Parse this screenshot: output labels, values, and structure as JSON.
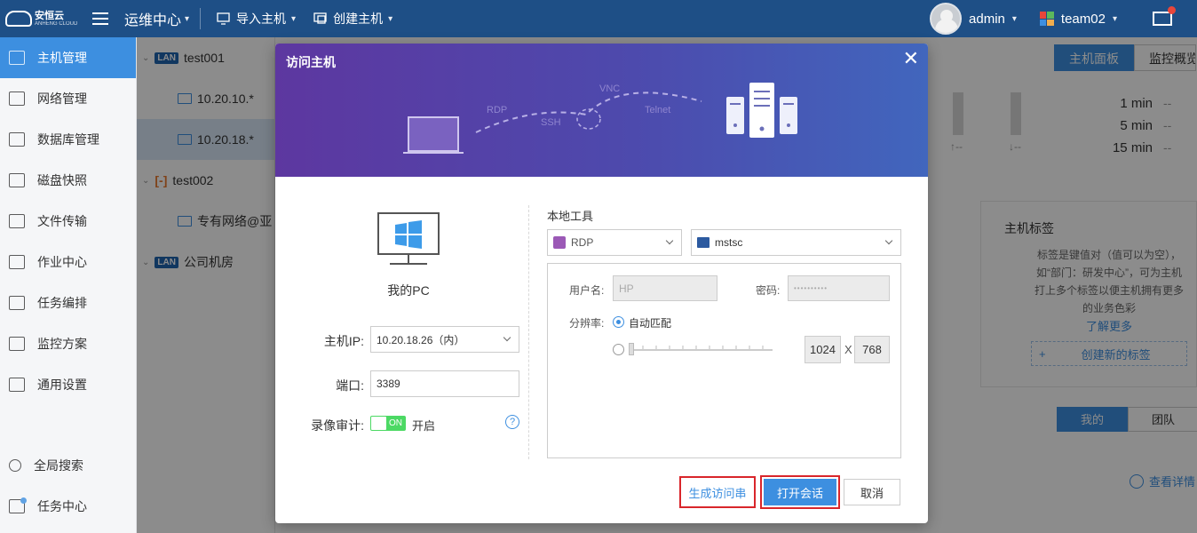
{
  "topbar": {
    "logo_text": "安恒云",
    "logo_sub": "ANHENG CLOUD",
    "menu": "运维中心",
    "import_host": "导入主机",
    "create_host": "创建主机",
    "user": "admin",
    "team": "team02"
  },
  "sidebar": {
    "items": [
      {
        "label": "主机管理",
        "icon": "monitor-icon",
        "active": true
      },
      {
        "label": "网络管理",
        "icon": "network-icon"
      },
      {
        "label": "数据库管理",
        "icon": "database-icon"
      },
      {
        "label": "磁盘快照",
        "icon": "disk-icon"
      },
      {
        "label": "文件传输",
        "icon": "file-transfer-icon"
      },
      {
        "label": "作业中心",
        "icon": "clipboard-icon"
      },
      {
        "label": "任务编排",
        "icon": "task-icon"
      },
      {
        "label": "监控方案",
        "icon": "chart-icon"
      },
      {
        "label": "通用设置",
        "icon": "gear-icon"
      }
    ],
    "bottom": [
      {
        "label": "全局搜索",
        "icon": "search-icon"
      },
      {
        "label": "任务中心",
        "icon": "task-center-icon"
      }
    ]
  },
  "tree": {
    "groups": [
      {
        "badge": "LAN",
        "name": "test001"
      },
      {
        "host": "10.20.10.*"
      },
      {
        "host": "10.20.18.*"
      },
      {
        "badge": "[-]",
        "name": "test002"
      },
      {
        "host": "专有网络@亚"
      },
      {
        "badge": "LAN",
        "name": "公司机房"
      }
    ]
  },
  "background": {
    "tab_host_panel": "主机面板",
    "tab_monitor": "监控概览",
    "load_labels": [
      "1 min",
      "5 min",
      "15 min"
    ],
    "load_values": [
      "--",
      "--",
      "--"
    ],
    "bar_up": "↑--",
    "bar_down": "↓--",
    "tag_title": "主机标签",
    "tag_desc": "标签是键值对（值可以为空），如“部门：研发中心”，可为主机打上多个标签以便主机拥有更多的业务色彩",
    "tag_more": "了解更多",
    "tag_create_plus": "+",
    "tag_create": "创建新的标签",
    "tab_mine": "我的",
    "tab_team": "团队",
    "view_detail": "查看详情"
  },
  "dialog": {
    "title": "访问主机",
    "close": "✕",
    "art_labels": {
      "rdp": "RDP",
      "ssh": "SSH",
      "vnc": "VNC",
      "telnet": "Telnet"
    },
    "pc_label": "我的PC",
    "host_ip_label": "主机IP:",
    "host_ip_value": "10.20.18.26（内）",
    "port_label": "端口:",
    "port_value": "3389",
    "record_label": "录像审计:",
    "toggle_text": "ON",
    "record_state": "开启",
    "help": "?",
    "local_tool_title": "本地工具",
    "protocol": "RDP",
    "client": "mstsc",
    "username_label": "用户名:",
    "username_value": "HP",
    "password_label": "密码:",
    "password_value": "••••••••••",
    "resolution_label": "分辨率:",
    "auto_match": "自动匹配",
    "res_width": "1024",
    "res_x": "X",
    "res_height": "768",
    "btn_generate": "生成访问串",
    "btn_open": "打开会话",
    "btn_cancel": "取消"
  },
  "colors": {
    "topbar": "#1e4f86",
    "accent": "#3d8fe0",
    "highlight": "#d9262b",
    "toggle_on": "#4cd964"
  }
}
